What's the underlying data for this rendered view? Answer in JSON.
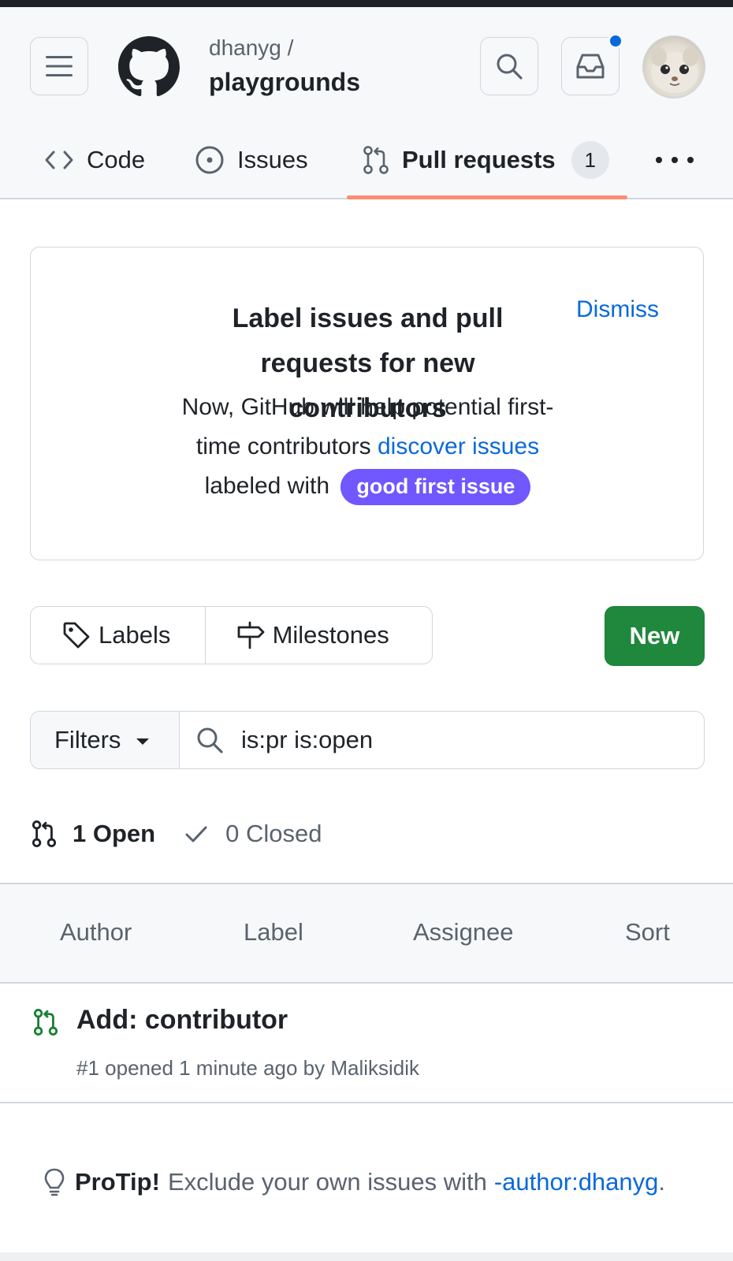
{
  "header": {
    "repo_owner": "dhanyg /",
    "repo_name": "playgrounds",
    "notification_dot_color": "#0969da"
  },
  "tabs": [
    {
      "label": "Code",
      "icon": "code-icon"
    },
    {
      "label": "Issues",
      "icon": "issue-opened-icon"
    },
    {
      "label": "Pull requests",
      "icon": "git-pull-request-icon",
      "counter": "1",
      "selected": true
    }
  ],
  "promo": {
    "title": "Label issues and pull requests for new contributors",
    "dismiss": "Dismiss",
    "body_1": "Now, GitHub will help potential first-",
    "body_2": "time contributors",
    "body_link": "discover issues",
    "body_3": "labeled with",
    "label": "good first issue",
    "label_color": "#7057ff"
  },
  "actions": {
    "labels": "Labels",
    "milestones": "Milestones",
    "new": "New",
    "new_color": "#1f883d"
  },
  "filter": {
    "button": "Filters",
    "query": "is:pr is:open"
  },
  "state": {
    "open": "1 Open",
    "closed": "0 Closed"
  },
  "list_header": [
    "Author",
    "Label",
    "Assignee",
    "Sort"
  ],
  "pull_requests": [
    {
      "title": "Add: contributor",
      "meta": "#1 opened 1 minute ago by Maliksidik",
      "state_color": "#1a7f37"
    }
  ],
  "protip": {
    "strong": "ProTip!",
    "text": "Exclude your own issues with",
    "link": "-author:dhanyg",
    "end": "."
  }
}
